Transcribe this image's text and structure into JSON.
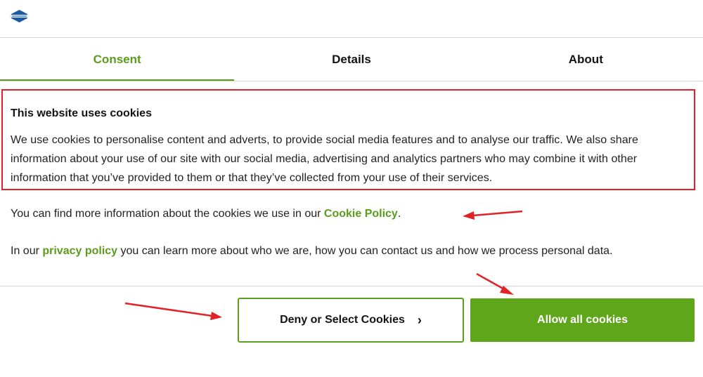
{
  "tabs": [
    "Consent",
    "Details",
    "About"
  ],
  "banner": {
    "title": "This website uses cookies",
    "body": "We use cookies to personalise content and adverts, to provide social media features and to analyse our traffic. We also share information about your use of our site with our social media, advertising and analytics partners who may combine it with other information that you’ve provided to them or that they’ve collected from your use of their services."
  },
  "info_line": {
    "prefix": "You can find more information about the cookies we use in our ",
    "link": "Cookie Policy",
    "suffix": "."
  },
  "privacy_line": {
    "prefix": "In our ",
    "link": "privacy policy",
    "suffix": " you can learn more about who we are, how you can contact us and how we process personal data."
  },
  "buttons": {
    "deny": "Deny or Select Cookies",
    "allow": "Allow all cookies"
  },
  "colors": {
    "accent": "#5b9c1c",
    "annotation": "#e32227"
  },
  "icons": {
    "deny_chevron": "chevron-right-icon",
    "logo": "logo-icon"
  }
}
